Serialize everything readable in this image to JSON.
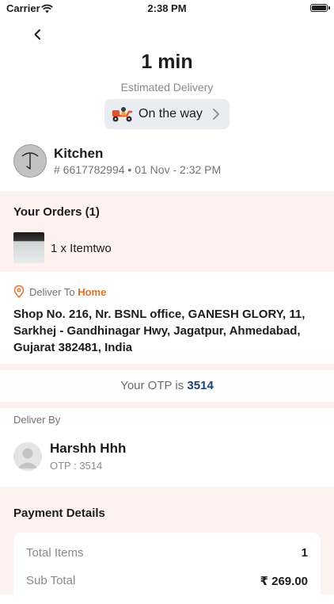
{
  "status_bar": {
    "carrier": "Carrier",
    "time": "2:38 PM"
  },
  "delivery": {
    "eta": "1 min",
    "eta_label": "Estimated Delivery",
    "status": "On the way",
    "status_icon": "scooter-icon"
  },
  "store": {
    "name": "Kitchen",
    "order_meta": "# 6617782994 • 01 Nov - 2:32 PM"
  },
  "orders": {
    "title": "Your Orders (1)",
    "items": [
      {
        "label": "1 x Itemtwo"
      }
    ]
  },
  "address": {
    "deliver_to_prefix": "Deliver To ",
    "deliver_to_type": "Home",
    "text": "Shop No. 216, Nr. BSNL office, GANESH GLORY, 11, Sarkhej - Gandhinagar Hwy, Jagatpur, Ahmedabad, Gujarat 382481, India"
  },
  "otp": {
    "prefix": "Your OTP is ",
    "code": "3514"
  },
  "driver": {
    "section_label": "Deliver By",
    "name": "Harshh Hhh",
    "otp_text": "OTP : 3514"
  },
  "payment": {
    "title": "Payment Details",
    "rows": [
      {
        "label": "Total Items",
        "value": "1"
      },
      {
        "label": "Sub Total",
        "value": "₹ 269.00"
      }
    ]
  },
  "colors": {
    "accent_orange": "#e0702a",
    "otp_blue": "#1f3f7a",
    "section_band": "#fdf2ef"
  }
}
